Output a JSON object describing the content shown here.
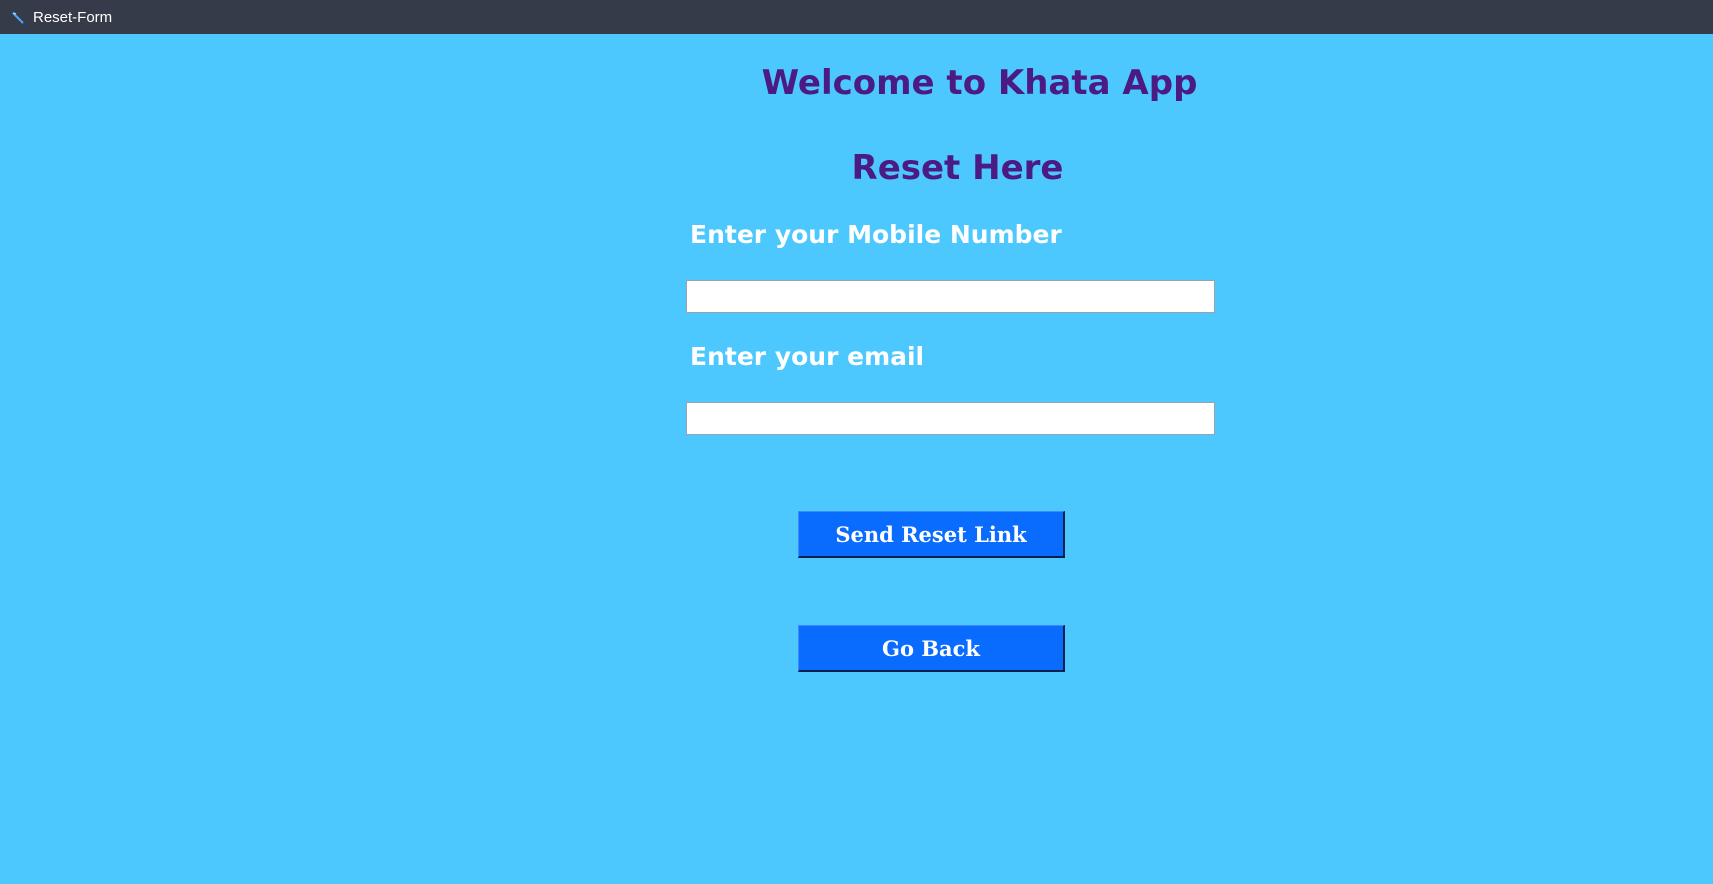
{
  "window": {
    "title": "Reset-Form",
    "icon": "feather-icon"
  },
  "page": {
    "welcome_heading": "Welcome to Khata App",
    "reset_heading": "Reset Here"
  },
  "form": {
    "mobile_label": "Enter your Mobile Number",
    "mobile_value": "",
    "email_label": "Enter your email",
    "email_value": "",
    "send_button_label": "Send Reset Link",
    "back_button_label": "Go Back"
  },
  "colors": {
    "background": "#4dc8ff",
    "titlebar": "#353b48",
    "heading": "#4b1a82",
    "button": "#0a6cff"
  }
}
